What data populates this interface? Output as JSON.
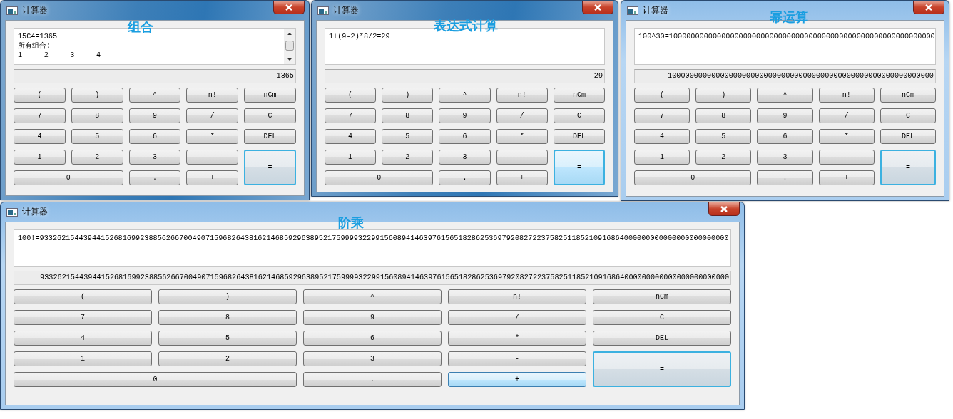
{
  "windows": [
    {
      "title": "计算器",
      "caption": "组合",
      "display": {
        "lines": [
          "15C4=1365",
          "所有组合:",
          "1     2     3     4"
        ],
        "scrollbar": true
      },
      "result": "1365",
      "buttons": [
        {
          "label": "(",
          "kind": "normal",
          "focused": false,
          "hover": false
        },
        {
          "label": ")",
          "kind": "normal",
          "focused": false,
          "hover": false
        },
        {
          "label": "^",
          "kind": "normal",
          "focused": false,
          "hover": false
        },
        {
          "label": "n!",
          "kind": "normal",
          "focused": false,
          "hover": false
        },
        {
          "label": "nCm",
          "kind": "normal",
          "focused": false,
          "hover": false
        },
        {
          "label": "7",
          "kind": "normal",
          "focused": false,
          "hover": false
        },
        {
          "label": "8",
          "kind": "normal",
          "focused": false,
          "hover": false
        },
        {
          "label": "9",
          "kind": "normal",
          "focused": false,
          "hover": false
        },
        {
          "label": "/",
          "kind": "normal",
          "focused": false,
          "hover": false
        },
        {
          "label": "C",
          "kind": "normal",
          "focused": false,
          "hover": false
        },
        {
          "label": "4",
          "kind": "normal",
          "focused": false,
          "hover": false
        },
        {
          "label": "5",
          "kind": "normal",
          "focused": false,
          "hover": false
        },
        {
          "label": "6",
          "kind": "normal",
          "focused": false,
          "hover": false
        },
        {
          "label": "*",
          "kind": "normal",
          "focused": false,
          "hover": false
        },
        {
          "label": "DEL",
          "kind": "normal",
          "focused": false,
          "hover": false
        },
        {
          "label": "1",
          "kind": "normal",
          "focused": false,
          "hover": false
        },
        {
          "label": "2",
          "kind": "normal",
          "focused": false,
          "hover": false
        },
        {
          "label": "3",
          "kind": "normal",
          "focused": false,
          "hover": false
        },
        {
          "label": "-",
          "kind": "normal",
          "focused": false,
          "hover": false
        },
        {
          "label": "=",
          "kind": "tall",
          "focused": true,
          "hover": false
        },
        {
          "label": "0",
          "kind": "wide",
          "focused": false,
          "hover": false
        },
        {
          "label": ".",
          "kind": "normal",
          "focused": false,
          "hover": false
        },
        {
          "label": "+",
          "kind": "normal",
          "focused": false,
          "hover": false
        }
      ]
    },
    {
      "title": "计算器",
      "caption": "表达式计算",
      "display": {
        "lines": [
          "1+(9-2)*8/2=29"
        ],
        "scrollbar": false
      },
      "result": "29",
      "buttons": [
        {
          "label": "(",
          "kind": "normal",
          "focused": false,
          "hover": false
        },
        {
          "label": ")",
          "kind": "normal",
          "focused": false,
          "hover": false
        },
        {
          "label": "^",
          "kind": "normal",
          "focused": false,
          "hover": false
        },
        {
          "label": "n!",
          "kind": "normal",
          "focused": false,
          "hover": false
        },
        {
          "label": "nCm",
          "kind": "normal",
          "focused": false,
          "hover": false
        },
        {
          "label": "7",
          "kind": "normal",
          "focused": false,
          "hover": false
        },
        {
          "label": "8",
          "kind": "normal",
          "focused": false,
          "hover": false
        },
        {
          "label": "9",
          "kind": "normal",
          "focused": false,
          "hover": false
        },
        {
          "label": "/",
          "kind": "normal",
          "focused": false,
          "hover": false
        },
        {
          "label": "C",
          "kind": "normal",
          "focused": false,
          "hover": false
        },
        {
          "label": "4",
          "kind": "normal",
          "focused": false,
          "hover": false
        },
        {
          "label": "5",
          "kind": "normal",
          "focused": false,
          "hover": false
        },
        {
          "label": "6",
          "kind": "normal",
          "focused": false,
          "hover": false
        },
        {
          "label": "*",
          "kind": "normal",
          "focused": false,
          "hover": false
        },
        {
          "label": "DEL",
          "kind": "normal",
          "focused": false,
          "hover": false
        },
        {
          "label": "1",
          "kind": "normal",
          "focused": false,
          "hover": false
        },
        {
          "label": "2",
          "kind": "normal",
          "focused": false,
          "hover": false
        },
        {
          "label": "3",
          "kind": "normal",
          "focused": false,
          "hover": false
        },
        {
          "label": "-",
          "kind": "normal",
          "focused": false,
          "hover": false
        },
        {
          "label": "=",
          "kind": "tall",
          "focused": true,
          "hover": true
        },
        {
          "label": "0",
          "kind": "wide",
          "focused": false,
          "hover": false
        },
        {
          "label": ".",
          "kind": "normal",
          "focused": false,
          "hover": false
        },
        {
          "label": "+",
          "kind": "normal",
          "focused": false,
          "hover": false
        }
      ]
    },
    {
      "title": "计算器",
      "caption": "幂运算",
      "display": {
        "lines": [
          "100^30=1000000000000000000000000000000000000000000000000000000000000"
        ],
        "scrollbar": false
      },
      "result": "1000000000000000000000000000000000000000000000000000000000000",
      "buttons": [
        {
          "label": "(",
          "kind": "normal",
          "focused": false,
          "hover": false
        },
        {
          "label": ")",
          "kind": "normal",
          "focused": false,
          "hover": false
        },
        {
          "label": "^",
          "kind": "normal",
          "focused": false,
          "hover": false
        },
        {
          "label": "n!",
          "kind": "normal",
          "focused": false,
          "hover": false
        },
        {
          "label": "nCm",
          "kind": "normal",
          "focused": false,
          "hover": false
        },
        {
          "label": "7",
          "kind": "normal",
          "focused": false,
          "hover": false
        },
        {
          "label": "8",
          "kind": "normal",
          "focused": false,
          "hover": false
        },
        {
          "label": "9",
          "kind": "normal",
          "focused": false,
          "hover": false
        },
        {
          "label": "/",
          "kind": "normal",
          "focused": false,
          "hover": false
        },
        {
          "label": "C",
          "kind": "normal",
          "focused": false,
          "hover": false
        },
        {
          "label": "4",
          "kind": "normal",
          "focused": false,
          "hover": false
        },
        {
          "label": "5",
          "kind": "normal",
          "focused": false,
          "hover": false
        },
        {
          "label": "6",
          "kind": "normal",
          "focused": false,
          "hover": false
        },
        {
          "label": "*",
          "kind": "normal",
          "focused": false,
          "hover": false
        },
        {
          "label": "DEL",
          "kind": "normal",
          "focused": false,
          "hover": false
        },
        {
          "label": "1",
          "kind": "normal",
          "focused": false,
          "hover": false
        },
        {
          "label": "2",
          "kind": "normal",
          "focused": false,
          "hover": false
        },
        {
          "label": "3",
          "kind": "normal",
          "focused": false,
          "hover": false
        },
        {
          "label": "-",
          "kind": "normal",
          "focused": false,
          "hover": false
        },
        {
          "label": "=",
          "kind": "tall",
          "focused": true,
          "hover": false
        },
        {
          "label": "0",
          "kind": "wide",
          "focused": false,
          "hover": false
        },
        {
          "label": ".",
          "kind": "normal",
          "focused": false,
          "hover": false
        },
        {
          "label": "+",
          "kind": "normal",
          "focused": false,
          "hover": false
        }
      ]
    },
    {
      "title": "计算器",
      "caption": "阶乘",
      "display": {
        "lines": [
          "100!=93326215443944152681699238856266700490715968264381621468592963895217599993229915608941463976156518286253697920827223758251185210916864000000000000000000000000"
        ],
        "scrollbar": false
      },
      "result": "93326215443944152681699238856266700490715968264381621468592963895217599993229915608941463976156518286253697920827223758251185210916864000000000000000000000000",
      "buttons": [
        {
          "label": "(",
          "kind": "normal",
          "focused": false,
          "hover": false
        },
        {
          "label": ")",
          "kind": "normal",
          "focused": false,
          "hover": false
        },
        {
          "label": "^",
          "kind": "normal",
          "focused": false,
          "hover": false
        },
        {
          "label": "n!",
          "kind": "normal",
          "focused": false,
          "hover": false
        },
        {
          "label": "nCm",
          "kind": "normal",
          "focused": false,
          "hover": false
        },
        {
          "label": "7",
          "kind": "normal",
          "focused": false,
          "hover": false
        },
        {
          "label": "8",
          "kind": "normal",
          "focused": false,
          "hover": false
        },
        {
          "label": "9",
          "kind": "normal",
          "focused": false,
          "hover": false
        },
        {
          "label": "/",
          "kind": "normal",
          "focused": false,
          "hover": false
        },
        {
          "label": "C",
          "kind": "normal",
          "focused": false,
          "hover": false
        },
        {
          "label": "4",
          "kind": "normal",
          "focused": false,
          "hover": false
        },
        {
          "label": "5",
          "kind": "normal",
          "focused": false,
          "hover": false
        },
        {
          "label": "6",
          "kind": "normal",
          "focused": false,
          "hover": false
        },
        {
          "label": "*",
          "kind": "normal",
          "focused": false,
          "hover": false
        },
        {
          "label": "DEL",
          "kind": "normal",
          "focused": false,
          "hover": false
        },
        {
          "label": "1",
          "kind": "normal",
          "focused": false,
          "hover": false
        },
        {
          "label": "2",
          "kind": "normal",
          "focused": false,
          "hover": false
        },
        {
          "label": "3",
          "kind": "normal",
          "focused": false,
          "hover": false
        },
        {
          "label": "-",
          "kind": "normal",
          "focused": false,
          "hover": false
        },
        {
          "label": "=",
          "kind": "tall",
          "focused": true,
          "hover": false
        },
        {
          "label": "0",
          "kind": "wide",
          "focused": false,
          "hover": false
        },
        {
          "label": ".",
          "kind": "normal",
          "focused": false,
          "hover": false
        },
        {
          "label": "+",
          "kind": "normal",
          "focused": false,
          "hover": true
        }
      ]
    }
  ]
}
